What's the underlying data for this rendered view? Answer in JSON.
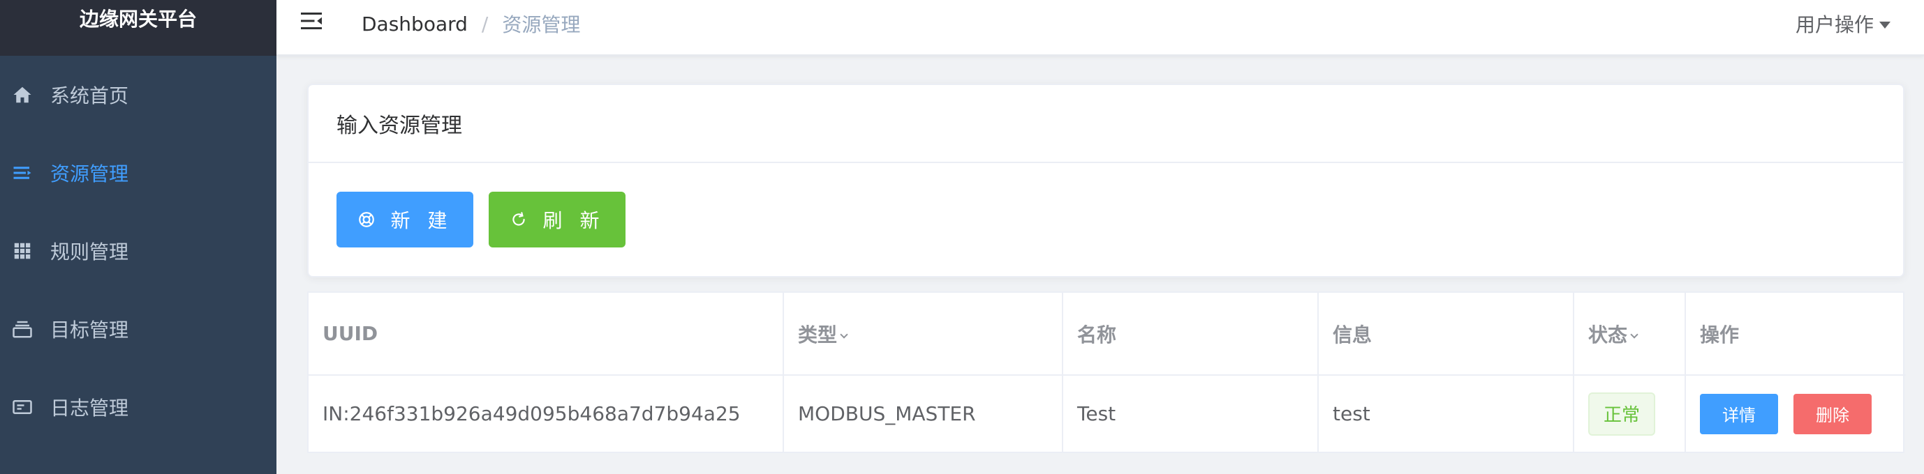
{
  "sidebar": {
    "brand": "边缘网关平台",
    "items": [
      {
        "label": "系统首页",
        "icon": "home-icon",
        "active": false
      },
      {
        "label": "资源管理",
        "icon": "list-indent-icon",
        "active": true
      },
      {
        "label": "规则管理",
        "icon": "grid-icon",
        "active": false
      },
      {
        "label": "目标管理",
        "icon": "stack-icon",
        "active": false
      },
      {
        "label": "日志管理",
        "icon": "log-card-icon",
        "active": false
      }
    ],
    "colors": {
      "bg": "#304156",
      "brand_bg": "#2b2f3a",
      "text": "#bfcbd9",
      "active": "#409eff"
    }
  },
  "navbar": {
    "breadcrumb_root": "Dashboard",
    "breadcrumb_sep": "/",
    "breadcrumb_current": "资源管理",
    "user_menu": "用户操作"
  },
  "card": {
    "title": "输入资源管理",
    "new_button": "新 建",
    "refresh_button": "刷 新"
  },
  "table": {
    "columns": [
      "UUID",
      "类型",
      "名称",
      "信息",
      "状态",
      "操作"
    ],
    "rows": [
      {
        "uuid": "IN:246f331b926a49d095b468a7d7b94a25",
        "type": "MODBUS_MASTER",
        "name": "Test",
        "info": "test",
        "status": "正常",
        "detail_label": "详情",
        "delete_label": "删除"
      }
    ]
  },
  "colors": {
    "primary": "#409eff",
    "success": "#67c23a",
    "danger": "#f56c6c"
  }
}
